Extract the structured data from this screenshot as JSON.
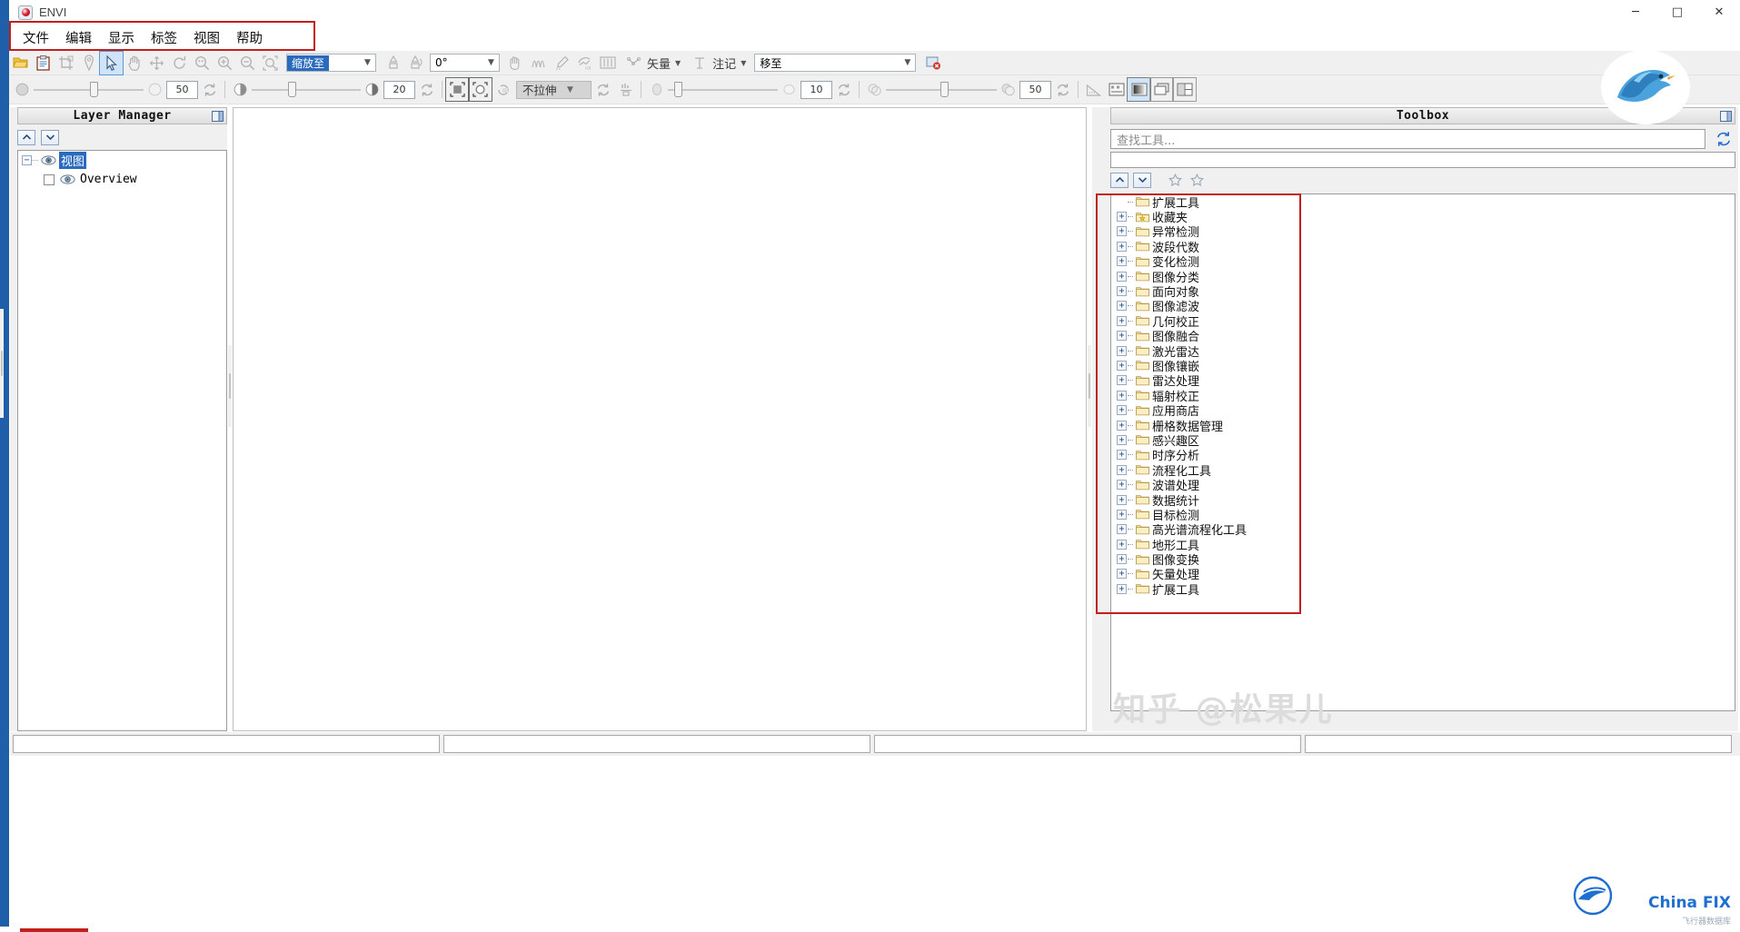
{
  "window": {
    "title": "ENVI",
    "app_icon": "envi-app-icon",
    "minimize": "─",
    "maximize": "□",
    "close": "✕"
  },
  "menubar": {
    "items": [
      {
        "label": "文件",
        "name": "file"
      },
      {
        "label": "编辑",
        "name": "edit"
      },
      {
        "label": "显示",
        "name": "display"
      },
      {
        "label": "标签",
        "name": "label"
      },
      {
        "label": "视图",
        "name": "view"
      },
      {
        "label": "帮助",
        "name": "help"
      }
    ],
    "highlight_color": "#c0211f"
  },
  "toolbar_row1": {
    "icons": [
      "open-file-icon",
      "paste-clipboard-icon",
      "crop-icon",
      "pin-marker-icon",
      "select-arrow-icon",
      "pan-hand-icon",
      "move-icon",
      "rotate-icon",
      "zoom-fit-icon",
      "zoom-in-icon",
      "zoom-out-icon",
      "zoom-region-icon"
    ],
    "zoom_combo": {
      "value": "缩放至",
      "name": "zoom-level-combo"
    },
    "after_zoom_icons": [
      "north-up-icon",
      "rotate-north-icon"
    ],
    "angle_combo": {
      "value": "0°",
      "name": "rotation-angle-combo"
    },
    "mid_icons": [
      "crosshair-icon",
      "spectral-profile-icon",
      "pencil-roi-icon",
      "region-roi-icon",
      "band-slider-icon"
    ],
    "vector_menu": {
      "label": "矢量",
      "icon": "vector-icon",
      "name": "vector-menu"
    },
    "annotation_menu": {
      "label": "注记",
      "icon": "annotation-icon",
      "name": "annotation-menu"
    },
    "goto_combo": {
      "value": "移至",
      "name": "goto-combo"
    },
    "end_icon": "flag-error-icon"
  },
  "toolbar_row2": {
    "brightness": {
      "icon": "brightness-icon",
      "value": "50",
      "name": "brightness-slider",
      "refresh": "refresh-icon"
    },
    "contrast": {
      "icon": "contrast-icon",
      "value": "20",
      "name": "contrast-slider",
      "refresh": "refresh-icon"
    },
    "fit_buttons": [
      "fit-to-window-icon",
      "fit-to-data-icon"
    ],
    "rotate_ccw_icon": "rotate-ccw-icon",
    "stretch_combo": {
      "value": "不拉伸",
      "name": "stretch-combo"
    },
    "stretch_refresh": "refresh-icon",
    "histogram_icon": "histogram-icon",
    "sharpen": {
      "icon": "sharpen-icon",
      "value": "10",
      "name": "sharpen-slider",
      "refresh": "refresh-icon"
    },
    "transparency": {
      "icon": "transparency-icon",
      "value": "50",
      "name": "transparency-slider",
      "refresh": "refresh-icon"
    },
    "end_icons": [
      "measure-icon",
      "scalebar-icon",
      "single-view-icon",
      "tile-view-icon",
      "split-view-icon"
    ]
  },
  "layer_manager": {
    "title": "Layer Manager",
    "pin_icon": "pin-panel-icon",
    "buttons": [
      {
        "name": "move-up-button",
        "icon": "chevron-up-icon"
      },
      {
        "name": "move-down-button",
        "icon": "chevron-down-icon"
      }
    ],
    "tree": [
      {
        "label": "视图",
        "name": "layer-view-root",
        "selected": true,
        "expander": "-",
        "icon": "eye-icon",
        "children": [
          {
            "label": "Overview",
            "name": "layer-overview",
            "selected": false,
            "expander": "",
            "icon": "eye-icon"
          }
        ]
      }
    ]
  },
  "map_view": {
    "name": "image-canvas",
    "background": "#ffffff"
  },
  "toolbox": {
    "title": "Toolbox",
    "pin_icon": "pin-panel-icon",
    "search": {
      "placeholder": "查找工具...",
      "value": "",
      "name": "toolbox-search-input"
    },
    "refresh_icon": "refresh-icon",
    "controls": [
      {
        "name": "collapse-all-button",
        "icon": "chevron-up-icon"
      },
      {
        "name": "expand-all-button",
        "icon": "chevron-down-icon"
      },
      {
        "name": "favorite-add-button",
        "icon": "star-outline-icon"
      },
      {
        "name": "favorite-remove-button",
        "icon": "star-outline-icon"
      }
    ],
    "highlight_color": "#c0211f",
    "tree": [
      {
        "label": "扩展工具",
        "name": "tool-extensions-top",
        "expandable": false,
        "icon": "folder-icon"
      },
      {
        "label": "收藏夹",
        "name": "tool-favorites",
        "expandable": true,
        "icon": "folder-star-icon"
      },
      {
        "label": "异常检测",
        "name": "tool-anomaly-detection",
        "expandable": true,
        "icon": "folder-icon"
      },
      {
        "label": "波段代数",
        "name": "tool-band-algebra",
        "expandable": true,
        "icon": "folder-icon"
      },
      {
        "label": "变化检测",
        "name": "tool-change-detection",
        "expandable": true,
        "icon": "folder-icon"
      },
      {
        "label": "图像分类",
        "name": "tool-classification",
        "expandable": true,
        "icon": "folder-icon"
      },
      {
        "label": "面向对象",
        "name": "tool-feature-extraction",
        "expandable": true,
        "icon": "folder-icon"
      },
      {
        "label": "图像滤波",
        "name": "tool-filter",
        "expandable": true,
        "icon": "folder-icon"
      },
      {
        "label": "几何校正",
        "name": "tool-geometric-correction",
        "expandable": true,
        "icon": "folder-icon"
      },
      {
        "label": "图像融合",
        "name": "tool-image-fusion",
        "expandable": true,
        "icon": "folder-icon"
      },
      {
        "label": "激光雷达",
        "name": "tool-lidar",
        "expandable": true,
        "icon": "folder-icon"
      },
      {
        "label": "图像镶嵌",
        "name": "tool-mosaicking",
        "expandable": true,
        "icon": "folder-icon"
      },
      {
        "label": "雷达处理",
        "name": "tool-radar",
        "expandable": true,
        "icon": "folder-icon"
      },
      {
        "label": "辐射校正",
        "name": "tool-radiometric-correction",
        "expandable": true,
        "icon": "folder-icon"
      },
      {
        "label": "应用商店",
        "name": "tool-app-store",
        "expandable": true,
        "icon": "folder-icon"
      },
      {
        "label": "栅格数据管理",
        "name": "tool-raster-management",
        "expandable": true,
        "icon": "folder-icon"
      },
      {
        "label": "感兴趣区",
        "name": "tool-regions-of-interest",
        "expandable": true,
        "icon": "folder-icon"
      },
      {
        "label": "时序分析",
        "name": "tool-time-series",
        "expandable": true,
        "icon": "folder-icon"
      },
      {
        "label": "流程化工具",
        "name": "tool-workflows",
        "expandable": true,
        "icon": "folder-icon"
      },
      {
        "label": "波谱处理",
        "name": "tool-spectral",
        "expandable": true,
        "icon": "folder-icon"
      },
      {
        "label": "数据统计",
        "name": "tool-statistics",
        "expandable": true,
        "icon": "folder-icon"
      },
      {
        "label": "目标检测",
        "name": "tool-target-detection",
        "expandable": true,
        "icon": "folder-icon"
      },
      {
        "label": "高光谱流程化工具",
        "name": "tool-hyperspectral-workflows",
        "expandable": true,
        "icon": "folder-icon"
      },
      {
        "label": "地形工具",
        "name": "tool-terrain",
        "expandable": true,
        "icon": "folder-icon"
      },
      {
        "label": "图像变换",
        "name": "tool-transform",
        "expandable": true,
        "icon": "folder-icon"
      },
      {
        "label": "矢量处理",
        "name": "tool-vector",
        "expandable": true,
        "icon": "folder-icon"
      },
      {
        "label": "扩展工具",
        "name": "tool-extensions",
        "expandable": true,
        "icon": "folder-icon"
      }
    ]
  },
  "statusbar": {
    "cells": [
      "",
      "",
      "",
      ""
    ]
  },
  "watermarks": {
    "zhihu": "知乎 @松果儿",
    "fx_title": "China FIX",
    "fx_sub": "飞行器数据库"
  }
}
